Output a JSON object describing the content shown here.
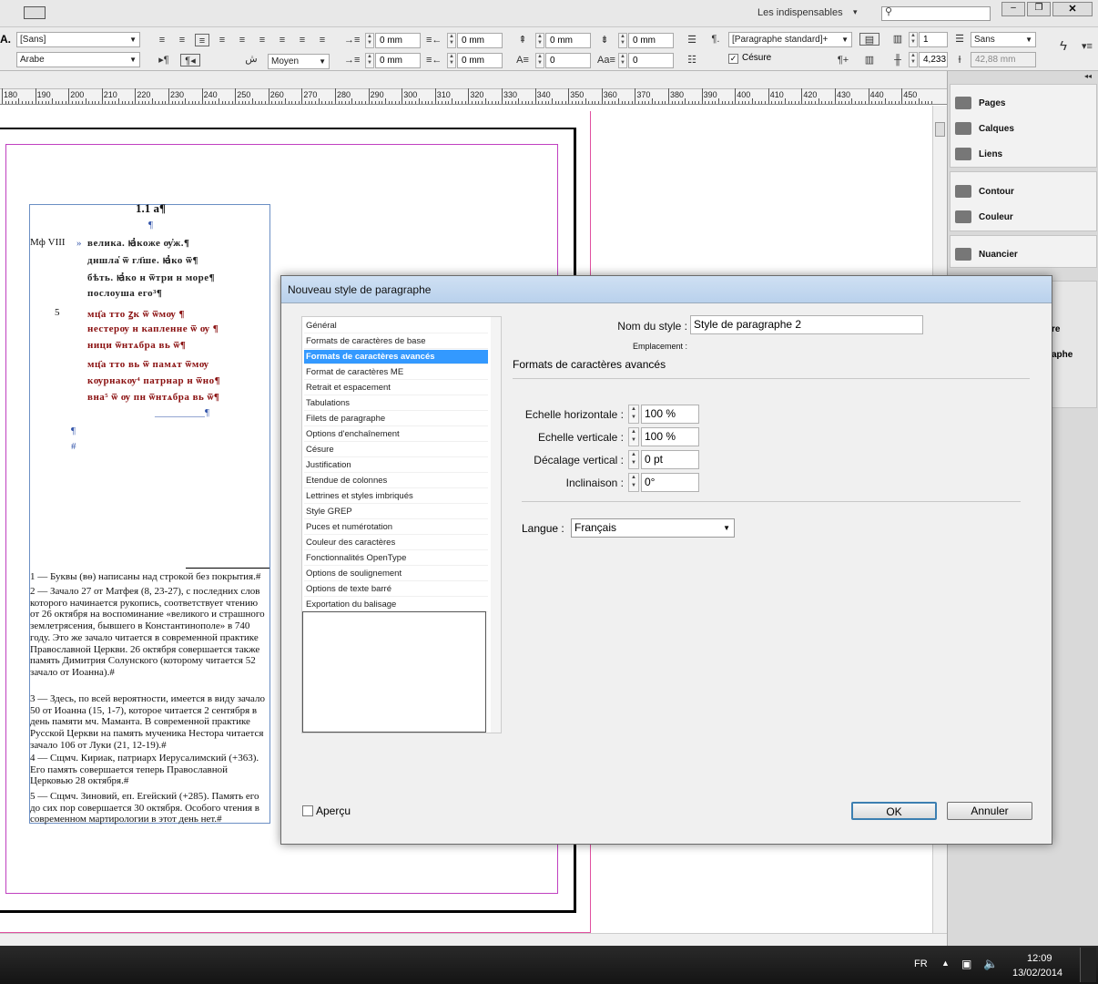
{
  "app": {
    "workspace": "Les indispensables",
    "workspace_arrow": "▾"
  },
  "control": {
    "font_family": "[Sans]",
    "font_style": "Arabe",
    "digits": "Moyen",
    "indent_left": "0 mm",
    "indent_right": "0 mm",
    "space_before": "0 mm",
    "space_after": "0 mm",
    "indent_first": "0 mm",
    "indent_last": "0 mm",
    "drop_lines": "0",
    "drop_chars": "0",
    "para_style": "[Paragraphe standard]+",
    "hyphen_label": "Césure",
    "columns": "1",
    "gutter": "4,233",
    "font2": "Sans",
    "width": "42,88 mm",
    "style_A": "A."
  },
  "ruler": {
    "ticks": [
      "180",
      "190",
      "200",
      "210",
      "220",
      "230",
      "240",
      "250",
      "260",
      "270",
      "280",
      "290",
      "300",
      "310",
      "320",
      "330",
      "340",
      "350",
      "360",
      "370",
      "380",
      "390",
      "400",
      "410",
      "420",
      "430",
      "440",
      "450"
    ]
  },
  "panel": {
    "items": [
      "Pages",
      "Calques",
      "Liens",
      "Contour",
      "Couleur",
      "Nuancier"
    ],
    "partial": [
      "re",
      "aphe"
    ]
  },
  "document": {
    "heading": "1.1 а¶",
    "pilcrow": "¶",
    "hash": "#",
    "margin_ref": "Мф VIII",
    "verse_num": "5",
    "bullet": "»",
    "slav_lines": [
      "велика.  ꙗ҆коже  ѹ҆ж.¶",
      "дншла҅ ѿ гл҃ше.  ꙗ҆ко  ѿ¶",
      "бѣть.  ꙗ҆ко  н  ѿтри  н  море¶",
      "послоуша  его³¶",
      "мц҃а  тто  ꙁк  ѿ  ѿмѹ ¶",
      "нестерѹ  н  капленне  ѿ ѹ ¶",
      "ници  ѿнтѧбра  вь  ѿ¶",
      "мц҃а  тто  вь  ѿ  памѧт  ѿмѹ",
      "кѹрнакѹ⁴  патрнар  н  ѿно¶",
      "вна⁵  ѿ ѹ  пн  ѿнтѧбра  вь  ѿ¶"
    ],
    "blank_line": "__________¶",
    "footnotes": [
      "1 — Буквы (вѳ) написаны над строкой без покрытия.#",
      "2 — Зачало 27 от Матфея (8, 23-27), с последних слов которого начинается рукопись, соответствует чтению от 26 октября на воспоминание «великого и страшного землетрясения, бывшего в Константинополе» в 740 году. Это же зачало читается в современной практике Православной Церкви. 26 октября совершается также память Димитрия Солунского (которому читается 52 зачало от Иоанна).#",
      "3 — Здесь, по всей вероятности, имеется в виду зачало 50 от Иоанна (15, 1-7), которое читается 2 сентября в день памяти мч. Маманта. В современной практике Русской Церкви на память мученика Нестора читается зачало 106 от Луки (21, 12-19).#",
      "4 — Сщмч. Кириак, патриарх Иерусалимский (+363). Его память совершается теперь Православной Церковью 28 октября.#",
      "5 — Сщмч. Зиновий, еп. Егейский (+285). Память его до сих пор совершается 30 октября. Особого чтения в современном мартирологии в этот день нет.#"
    ]
  },
  "dialog": {
    "title": "Nouveau style de paragraphe",
    "categories": [
      "Général",
      "Formats de caractères de base",
      "Formats de caractères avancés",
      "Format de caractères ME",
      "Retrait et espacement",
      "Tabulations",
      "Filets de paragraphe",
      "Options d'enchaînement",
      "Césure",
      "Justification",
      "Etendue de colonnes",
      "Lettrines et styles imbriqués",
      "Style GREP",
      "Puces et numérotation",
      "Couleur des caractères",
      "Fonctionnalités OpenType",
      "Options de soulignement",
      "Options de texte barré",
      "Exportation du balisage"
    ],
    "style_name_label": "Nom du style :",
    "style_name": "Style de paragraphe 2",
    "location_label": "Emplacement :",
    "section_title": "Formats de caractères avancés",
    "h_scale_label": "Echelle horizontale :",
    "h_scale": "100 %",
    "v_scale_label": "Echelle verticale :",
    "v_scale": "100 %",
    "baseline_label": "Décalage vertical :",
    "baseline": "0 pt",
    "skew_label": "Inclinaison :",
    "skew": "0°",
    "language_label": "Langue :",
    "language": "Français",
    "preview_label": "Aperçu",
    "ok": "OK",
    "cancel": "Annuler"
  },
  "taskbar": {
    "lang": "FR",
    "time": "12:09",
    "date": "13/02/2014"
  }
}
